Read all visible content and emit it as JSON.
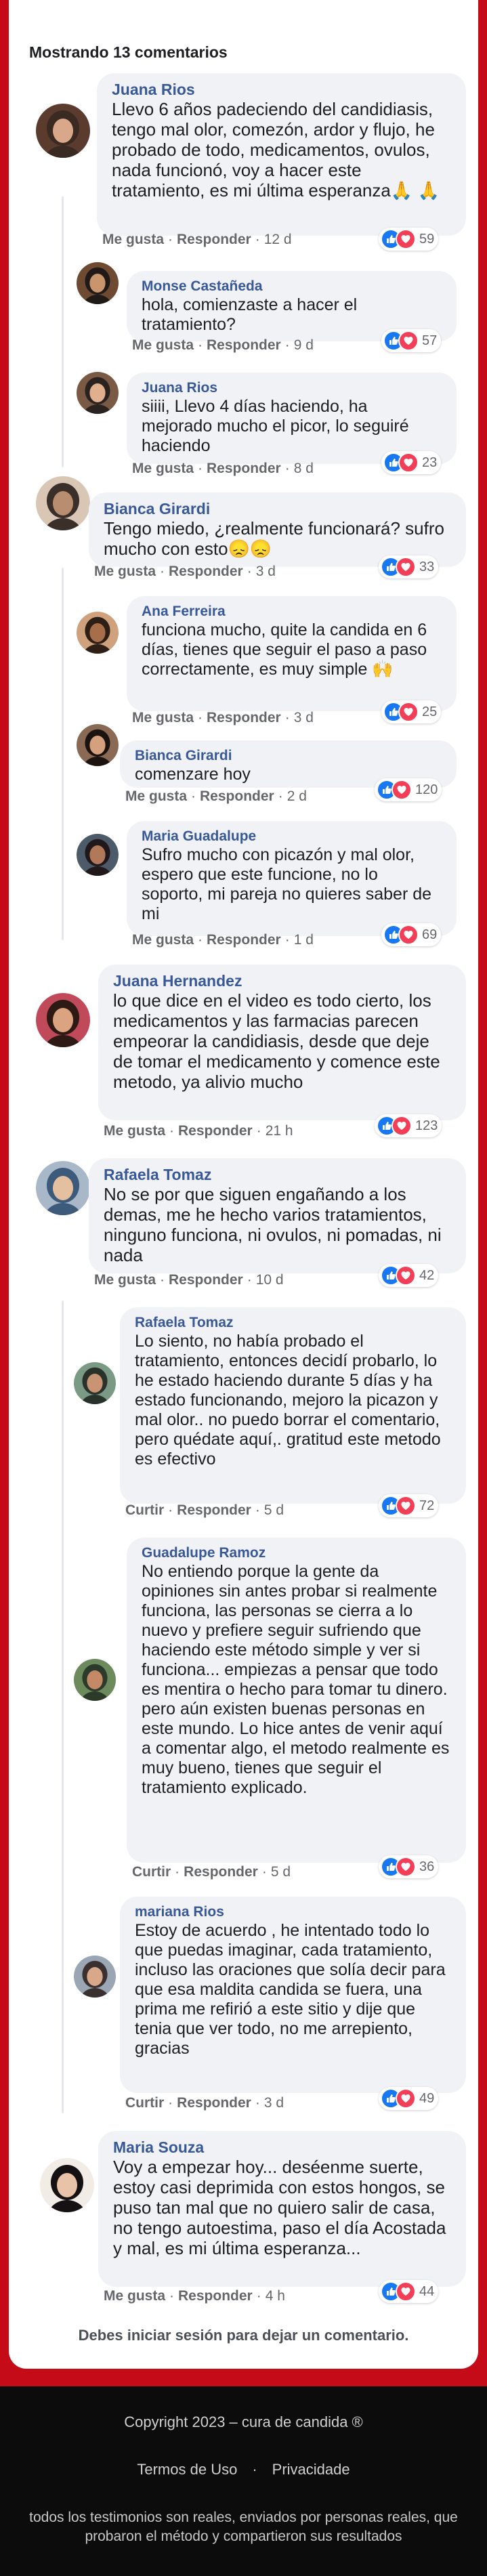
{
  "header": {
    "title": "Mostrando 13 comentarios"
  },
  "labels": {
    "like": "Me gusta",
    "reply": "Responder",
    "curtir": "Curtir",
    "dot": "·"
  },
  "comments": [
    {
      "name": "Juana Rios",
      "text": "Llevo 6 años padeciendo del candidiasis, tengo mal olor, comezón, ardor y flujo, he probado de todo, medicamentos, ovulos, nada funcionó, voy a hacer este tratamiento, es mi última esperanza🙏 🙏",
      "time": "12 d",
      "count": "59"
    },
    {
      "name": "Monse Castañeda",
      "text": "hola, comienzaste a hacer el tratamiento?",
      "time": "9 d",
      "count": "57"
    },
    {
      "name": "Juana Rios",
      "text": "siiii, Llevo 4 días haciendo, ha mejorado mucho el picor, lo seguiré haciendo",
      "time": "8 d",
      "count": "23"
    },
    {
      "name": "Bianca Girardi",
      "text": "Tengo miedo, ¿realmente funcionará? sufro mucho con esto😞😞",
      "time": "3 d",
      "count": "33"
    },
    {
      "name": "Ana Ferreira",
      "text": "funciona mucho, quite la candida en 6 días, tienes que seguir el paso a paso correctamente, es muy simple 🙌",
      "time": "3 d",
      "count": "25"
    },
    {
      "name": "Bianca Girardi",
      "text": "comenzare hoy",
      "time": "2 d",
      "count": "120"
    },
    {
      "name": "Maria Guadalupe",
      "text": "Sufro mucho con picazón y mal olor, espero que este funcione, no lo soporto, mi pareja no quieres saber de mi",
      "time": "1 d",
      "count": "69"
    },
    {
      "name": "Juana Hernandez",
      "text": "lo que dice en el video es todo cierto, los medicamentos y las farmacias parecen empeorar la candidiasis, desde que deje de tomar el medicamento y comence este metodo, ya alivio mucho",
      "time": "21 h",
      "count": "123"
    },
    {
      "name": "Rafaela Tomaz",
      "text": "No se por que siguen engañando a los demas, me he hecho varios tratamientos, ninguno funciona, ni ovulos, ni pomadas, ni nada",
      "time": "10 d",
      "count": "42"
    },
    {
      "name": "Rafaela Tomaz",
      "text": "Lo siento, no había probado el tratamiento, entonces decidí probarlo, lo he estado haciendo durante 5 días y ha estado funcionando, mejoro la picazon y mal olor.. no puedo borrar el comentario, pero quédate aquí,. gratitud este metodo es efectivo",
      "time": "5 d",
      "count": "72"
    },
    {
      "name": "Guadalupe Ramoz",
      "text": "No entiendo porque la gente da opiniones sin antes probar si realmente funciona, las personas se cierra a lo nuevo y prefiere seguir sufriendo que haciendo este método simple y ver si funciona... empiezas a pensar que todo es mentira o hecho para tomar tu dinero. pero aún existen buenas personas en este mundo. Lo hice antes de venir aquí a comentar algo, el metodo realmente es muy bueno, tienes que seguir el tratamiento explicado.",
      "time": "5 d",
      "count": "36"
    },
    {
      "name": "mariana Rios",
      "text": "Estoy de acuerdo , he intentado todo lo que puedas imaginar, cada tratamiento, incluso las oraciones que solía decir para que esa maldita candida se fuera, una prima me refirió a este sitio y dije que tenia que ver todo, no me arrepiento, gracias",
      "time": "3 d",
      "count": "49"
    },
    {
      "name": "Maria Souza",
      "text": "Voy a empezar hoy... deséenme suerte, estoy casi deprimida con estos hongos, se puso tan mal que no quiero salir de casa, no tengo autoestima, paso el día Acostada y mal, es mi última esperanza...",
      "time": "4 h",
      "count": "44"
    }
  ],
  "footer": {
    "login_note": "Debes iniciar sesión para dejar un comentario.",
    "copyright": "Copyright 2023 – cura de candida ®",
    "terms": "Termos de Uso",
    "separator": "·",
    "privacy": "Privacidade",
    "disclaimer": "todos los testimonios son reales, enviados por personas reales, que probaron el método y compartieron sus resultados"
  },
  "colors": {
    "accent": "#c40b17",
    "name": "#385898",
    "bubble": "#f0f2f5",
    "like": "#1877f2",
    "love": "#f33e58"
  }
}
